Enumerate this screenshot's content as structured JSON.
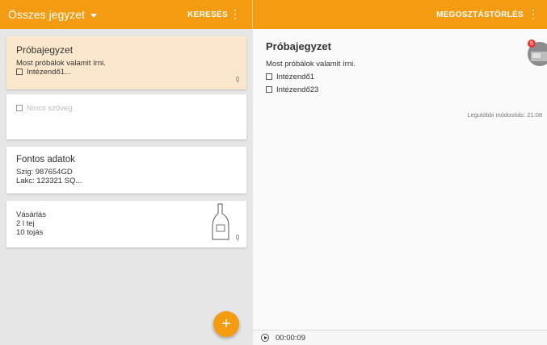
{
  "topbar": {
    "title": "Összes jegyzet",
    "search_label": "KERESÉS",
    "share_label": "MEGOSZTÁS",
    "delete_label": "TÖRLÉS"
  },
  "notes": [
    {
      "title": "Próbajegyzet",
      "text": "Most próbálok valamit írni.",
      "item": "Intézendő1..."
    },
    {
      "placeholder": "Nincs szöveg"
    },
    {
      "title": "Fontos adatok",
      "lines": [
        "Szig: 987654GD",
        "Lakc: 123321 SQ..."
      ]
    },
    {
      "title": "Vásárlás",
      "lines": [
        "2 l tej",
        "10 tojás"
      ]
    }
  ],
  "fab_label": "+",
  "detail": {
    "title": "Próbajegyzet",
    "text": "Most próbálok valamit írni.",
    "items": [
      "Intézendő1",
      "Intézendő23"
    ],
    "modified": "Legutóbbi módosítás: 21:08",
    "badge": "5",
    "audio_time": "00:00:09"
  },
  "colors": {
    "accent": "#f39c12",
    "selected_note": "#fbe8cc",
    "badge": "#e53935"
  }
}
